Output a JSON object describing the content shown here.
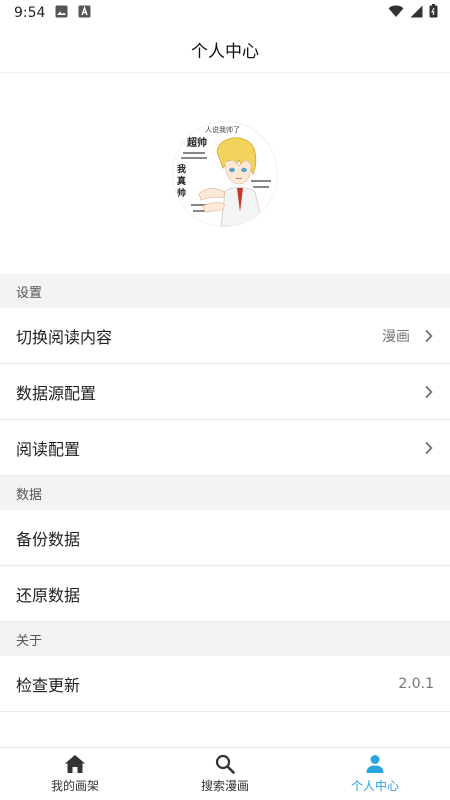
{
  "status_bar": {
    "time": "9:54"
  },
  "header": {
    "title": "个人中心"
  },
  "sections": {
    "settings": {
      "title": "设置",
      "items": [
        {
          "label": "切换阅读内容",
          "value": "漫画"
        },
        {
          "label": "数据源配置"
        },
        {
          "label": "阅读配置"
        }
      ]
    },
    "data": {
      "title": "数据",
      "items": [
        {
          "label": "备份数据"
        },
        {
          "label": "还原数据"
        }
      ]
    },
    "about": {
      "title": "关于",
      "items": [
        {
          "label": "检查更新",
          "value": "2.0.1"
        }
      ]
    }
  },
  "bottom_nav": {
    "items": [
      {
        "label": "我的画架",
        "icon": "home-icon"
      },
      {
        "label": "搜索漫画",
        "icon": "search-icon"
      },
      {
        "label": "个人中心",
        "icon": "person-icon",
        "active": true
      }
    ]
  },
  "colors": {
    "accent": "#2aa4de",
    "section_bg": "#f2f3f5"
  },
  "avatar": {
    "text_lines": [
      "人说我帅了",
      "超帅",
      "我真帅"
    ]
  }
}
